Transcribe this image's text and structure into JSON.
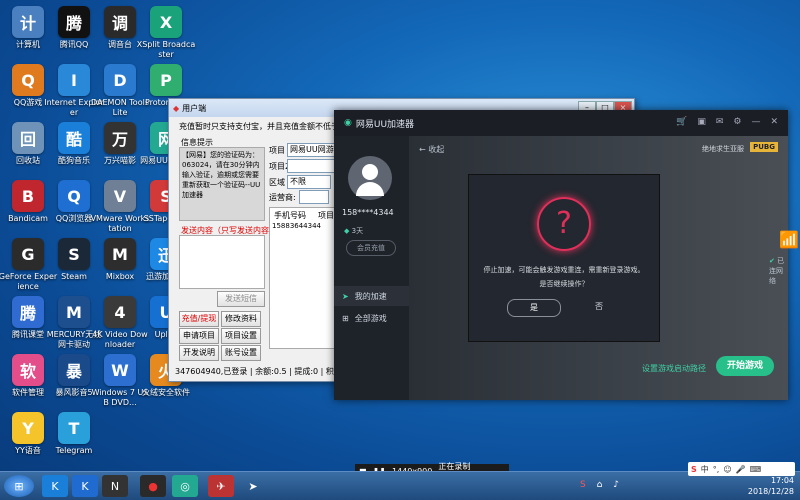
{
  "desktop_icons": [
    {
      "label": "计算机",
      "icon": "computer-icon",
      "color": "#4a7fc0"
    },
    {
      "label": "腾讯QQ",
      "icon": "qq-penguin-icon",
      "color": "#111111"
    },
    {
      "label": "调音台",
      "icon": "mixer-icon",
      "color": "#2a2a2a"
    },
    {
      "label": "XSplit Broadcaster",
      "icon": "xsplit-icon",
      "color": "#1aa37a"
    },
    {
      "label": "QQ游戏",
      "icon": "qq-game-icon",
      "color": "#e07a1f"
    },
    {
      "label": "Internet Explorer",
      "icon": "ie-icon",
      "color": "#2a88d8"
    },
    {
      "label": "DAEMON Tools Lite",
      "icon": "daemon-icon",
      "color": "#2a7ad0"
    },
    {
      "label": "ProtonVPN",
      "icon": "protonvpn-icon",
      "color": "#2fae6f"
    },
    {
      "label": "回收站",
      "icon": "recycle-bin-icon",
      "color": "#6f93b8"
    },
    {
      "label": "酷狗音乐",
      "icon": "kugou-icon",
      "color": "#1a7fd8"
    },
    {
      "label": "万兴喵影",
      "icon": "filmora-icon",
      "color": "#333333"
    },
    {
      "label": "网易UU加速器",
      "icon": "uu-icon",
      "color": "#23a892"
    },
    {
      "label": "Bandicam",
      "icon": "bandicam-icon",
      "color": "#c0262d"
    },
    {
      "label": "QQ浏览器",
      "icon": "qq-browser-icon",
      "color": "#1e6fd1"
    },
    {
      "label": "VMware Workstation",
      "icon": "vmware-icon",
      "color": "#6f7f95"
    },
    {
      "label": "SSTap-beta",
      "icon": "sstap-icon",
      "color": "#d23a3a"
    },
    {
      "label": "GeForce Experience",
      "icon": "geforce-icon",
      "color": "#2b2b2b"
    },
    {
      "label": "Steam",
      "icon": "steam-icon",
      "color": "#1b2838"
    },
    {
      "label": "Mixbox",
      "icon": "mixbox-icon",
      "color": "#2d2d2d"
    },
    {
      "label": "迅游加速器",
      "icon": "xunyou-icon",
      "color": "#1e88e5"
    },
    {
      "label": "腾讯课堂",
      "icon": "tencent-class-icon",
      "color": "#2f6bd0"
    },
    {
      "label": "MERCURY无线网卡驱动",
      "icon": "mercury-icon",
      "color": "#1d4f8f"
    },
    {
      "label": "4K Video Downloader",
      "icon": "4k-video-icon",
      "color": "#3a3a3a"
    },
    {
      "label": "Uplay",
      "icon": "uplay-icon",
      "color": "#1570d1"
    },
    {
      "label": "软件管理",
      "icon": "software-manager-icon",
      "color": "#e34d8a"
    },
    {
      "label": "暴风影音5",
      "icon": "baofeng-icon",
      "color": "#1a4a8a"
    },
    {
      "label": "Windows 7 USB DVD...",
      "icon": "win7-usb-icon",
      "color": "#2d6fd1"
    },
    {
      "label": "火绒安全软件",
      "icon": "huorong-icon",
      "color": "#e68a1f"
    },
    {
      "label": "YY语音",
      "icon": "yy-icon",
      "color": "#f5c42a"
    },
    {
      "label": "Telegram",
      "icon": "telegram-icon",
      "color": "#2aa0da"
    }
  ],
  "sms_window": {
    "title": "用户端",
    "notice": "充值暂时只支持支付宝，并且充值金额不低于5元，客",
    "info_title": "信息提示",
    "info_text": "【网易】您的验证码为：063024，请在30分钟内输入验证，逾期或您需要重新获取一个验证码--UU加速器",
    "send_title": "发送内容（只写发送内容）",
    "send_button": "发送短信",
    "project_label": "项目",
    "project_value": "网易UU网游加速",
    "project2_label": "项目2:",
    "region_label": "区域",
    "region_value": "不限",
    "operator_label": "运营商:",
    "col_phone": "手机号码",
    "col_project": "项目",
    "phone_value": "15883644344",
    "buttons": [
      "充值/提现",
      "修改资料",
      "申请项目",
      "项目设置",
      "开发说明",
      "账号设置"
    ],
    "status": "347604940,已登录 | 余额:0.5 | 提成:0 | 积分:1 | 折扣"
  },
  "uu_app": {
    "brand": "网易UU加速器",
    "back_label": "收起",
    "game_title": "绝地求生亚服",
    "game_badge": "PUBG",
    "username": "158****4344",
    "vip_days": "3天",
    "vip_button": "会员充值",
    "menu": [
      "我的加速",
      "全部游戏"
    ],
    "wifi_label": "已连网络",
    "route_link": "设置游戏启动路径",
    "start_button": "开始游戏",
    "accent": "#27c08a"
  },
  "dialog": {
    "message1": "停止加速，可能会触发游戏重连，需重新登录游戏。",
    "message2": "是否继续操作？",
    "confirm": "是",
    "cancel": "否",
    "accent": "#e0305a"
  },
  "recorder": {
    "resolution": "1440x900",
    "status": "正在录制 [00:02:28]"
  },
  "taskbar": {
    "time": "17:04",
    "date": "2018/12/28",
    "ime": "中"
  }
}
